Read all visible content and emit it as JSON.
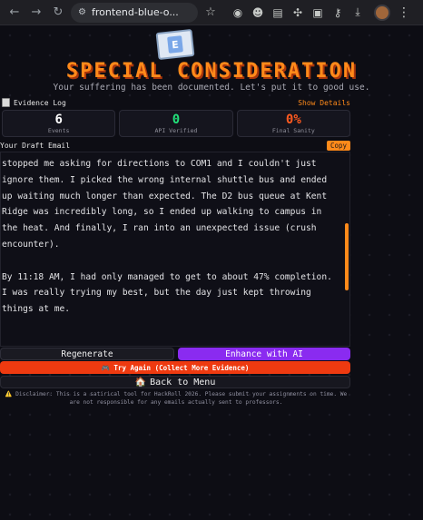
{
  "browser": {
    "url": "frontend-blue-o...",
    "back_glyph": "←",
    "forward_glyph": "→",
    "reload_glyph": "↻",
    "star_glyph": "☆"
  },
  "header": {
    "logo_letter": "E",
    "title": "SPECIAL CONSIDERATION",
    "subtitle": "Your suffering has been documented. Let's put it to good use."
  },
  "evidence_log": {
    "label": "Evidence Log",
    "show_details": "Show Details",
    "stats": [
      {
        "value": "6",
        "label": "Events",
        "color": "#ffffff"
      },
      {
        "value": "0",
        "label": "API Verified",
        "color": "#22e07a"
      },
      {
        "value": "0%",
        "label": "Final Sanity",
        "color": "#ff5a1f"
      }
    ]
  },
  "draft": {
    "label": "Your Draft Email",
    "copy_label": "Copy",
    "body": "stopped me asking for directions to COM1 and I couldn't just ignore them. I picked the wrong internal shuttle bus and ended up waiting much longer than expected. The D2 bus queue at Kent Ridge was incredibly long, so I ended up walking to campus in the heat. And finally, I ran into an unexpected issue (crush encounter).\n\nBy 11:18 AM, I had only managed to get to about 47% completion. I was really trying my best, but the day just kept throwing things at me.\n\n\nHonestly Prof, by the end of all this I wasn't in a great headspace. The stress really got to me. I'm thinking of reaching out to NUS University Counselling Services at UHC because today"
  },
  "actions": {
    "regenerate": "Regenerate",
    "enhance": "Enhance with AI",
    "try_again": "🎮 Try Again (Collect More Evidence)",
    "back_icon": "🏠",
    "back_menu": "Back to Menu"
  },
  "disclaimer": "⚠️ Disclaimer: This is a satirical tool for HackRoll 2026. Please submit your assignments on time. We are not responsible for any emails actually sent to professors."
}
